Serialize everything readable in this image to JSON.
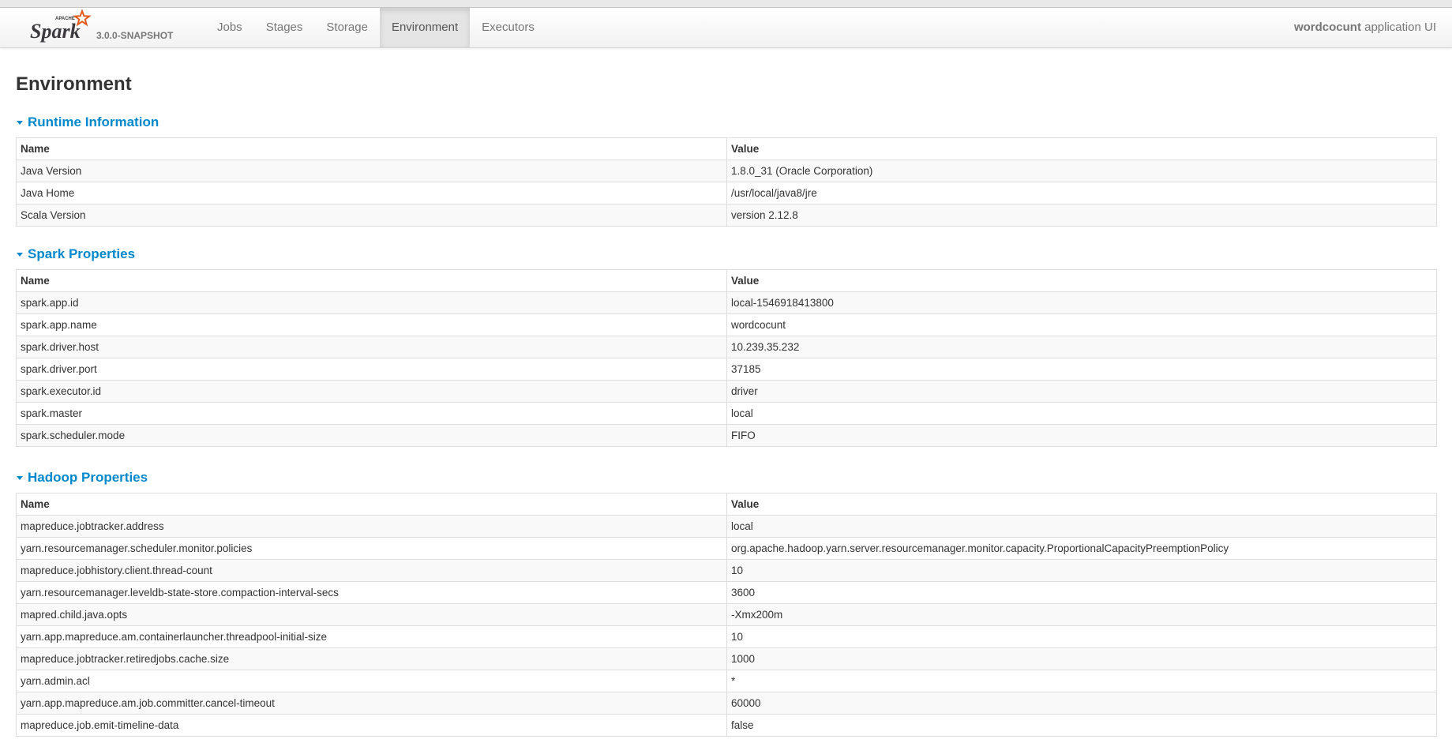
{
  "brand": {
    "logo_small": "APACHE",
    "logo_text": "Spark",
    "version": "3.0.0-SNAPSHOT"
  },
  "nav": {
    "tabs": [
      {
        "label": "Jobs",
        "active": false
      },
      {
        "label": "Stages",
        "active": false
      },
      {
        "label": "Storage",
        "active": false
      },
      {
        "label": "Environment",
        "active": true
      },
      {
        "label": "Executors",
        "active": false
      }
    ],
    "app_name": "wordcocunt",
    "app_suffix": " application UI"
  },
  "page": {
    "title": "Environment"
  },
  "colors": {
    "link": "#0088cc",
    "spark_orange": "#e25a1c",
    "logo_text": "#3c3a3e"
  },
  "runtime": {
    "title": "Runtime Information",
    "columns": [
      "Name",
      "Value"
    ],
    "rows": [
      [
        "Java Version",
        "1.8.0_31 (Oracle Corporation)"
      ],
      [
        "Java Home",
        "/usr/local/java8/jre"
      ],
      [
        "Scala Version",
        "version 2.12.8"
      ]
    ]
  },
  "spark": {
    "title": "Spark Properties",
    "columns": [
      "Name",
      "Value"
    ],
    "rows": [
      [
        "spark.app.id",
        "local-1546918413800"
      ],
      [
        "spark.app.name",
        "wordcocunt"
      ],
      [
        "spark.driver.host",
        "10.239.35.232"
      ],
      [
        "spark.driver.port",
        "37185"
      ],
      [
        "spark.executor.id",
        "driver"
      ],
      [
        "spark.master",
        "local"
      ],
      [
        "spark.scheduler.mode",
        "FIFO"
      ]
    ]
  },
  "hadoop": {
    "title": "Hadoop Properties",
    "columns": [
      "Name",
      "Value"
    ],
    "rows": [
      [
        "mapreduce.jobtracker.address",
        "local"
      ],
      [
        "yarn.resourcemanager.scheduler.monitor.policies",
        "org.apache.hadoop.yarn.server.resourcemanager.monitor.capacity.ProportionalCapacityPreemptionPolicy"
      ],
      [
        "mapreduce.jobhistory.client.thread-count",
        "10"
      ],
      [
        "yarn.resourcemanager.leveldb-state-store.compaction-interval-secs",
        "3600"
      ],
      [
        "mapred.child.java.opts",
        "-Xmx200m"
      ],
      [
        "yarn.app.mapreduce.am.containerlauncher.threadpool-initial-size",
        "10"
      ],
      [
        "mapreduce.jobtracker.retiredjobs.cache.size",
        "1000"
      ],
      [
        "yarn.admin.acl",
        "*"
      ],
      [
        "yarn.app.mapreduce.am.job.committer.cancel-timeout",
        "60000"
      ],
      [
        "mapreduce.job.emit-timeline-data",
        "false"
      ]
    ]
  }
}
